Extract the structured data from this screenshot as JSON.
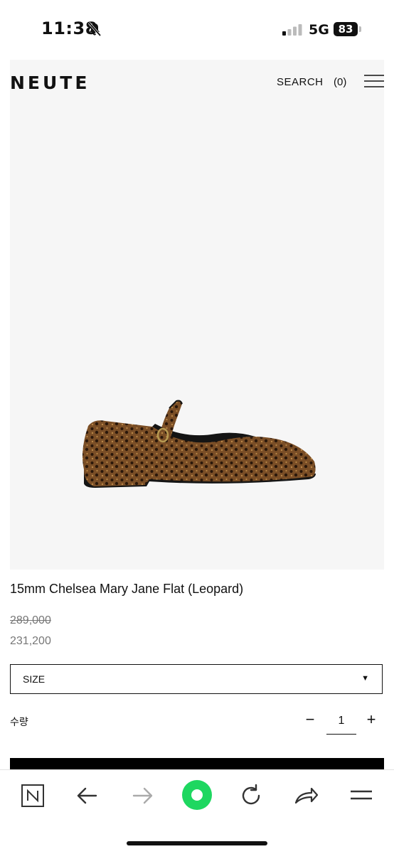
{
  "status_bar": {
    "time": "11:38",
    "network": "5G",
    "battery": "83",
    "icons": [
      "bell-slash-icon",
      "signal-icon",
      "battery-icon"
    ]
  },
  "header": {
    "logo": "NEUTE",
    "search_label": "SEARCH",
    "cart_label": "(0)",
    "menu_icon": "hamburger-menu-icon"
  },
  "product": {
    "image_alt_icon": "leopard-mary-jane-flat-image",
    "title": "15mm Chelsea Mary Jane Flat (Leopard)",
    "original_price": "289,000",
    "sale_price": "231,200",
    "size_select": {
      "label": "SIZE",
      "arrow": "▼"
    },
    "quantity": {
      "label": "수량",
      "minus": "−",
      "value": "1",
      "plus": "+"
    }
  },
  "browser_toolbar": {
    "buttons": [
      "naver-home-icon",
      "back-icon",
      "forward-icon",
      "green-dot-icon",
      "reload-icon",
      "share-icon",
      "menu-icon"
    ]
  },
  "colors": {
    "background": "#ffffff",
    "panel": "#f6f6f6",
    "text": "#111111",
    "muted": "#777777",
    "accent_green": "#1ed760"
  }
}
